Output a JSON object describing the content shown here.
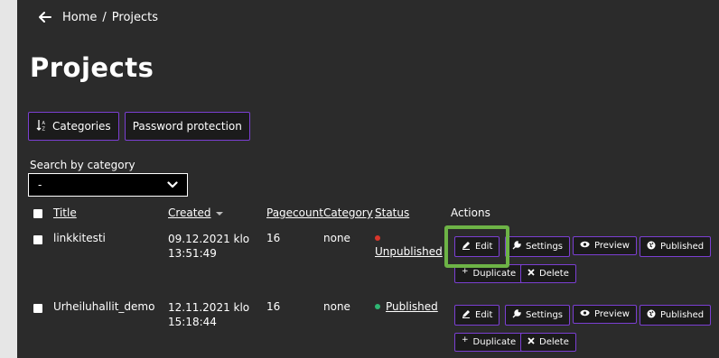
{
  "breadcrumb": {
    "items": [
      "Home",
      "/",
      "Projects"
    ]
  },
  "page": {
    "title": "Projects"
  },
  "top_buttons": {
    "categories": "Categories",
    "password_protection": "Password protection"
  },
  "search": {
    "label": "Search by category",
    "value": "-"
  },
  "table": {
    "headers": {
      "title": "Title",
      "created": "Created",
      "pagecount": "Pagecount",
      "category": "Category",
      "status": "Status",
      "actions": "Actions"
    },
    "rows": [
      {
        "title": "linkkitesti",
        "created_line1": "09.12.2021 klo",
        "created_line2": "13:51:49",
        "pagecount": "16",
        "category": "none",
        "status": "Unpublished",
        "status_color": "#d9362b"
      },
      {
        "title": "Urheiluhallit_demo",
        "created_line1": "12.11.2021 klo",
        "created_line2": "15:18:44",
        "pagecount": "16",
        "category": "none",
        "status": "Published",
        "status_color": "#2fb673"
      }
    ],
    "actions": {
      "edit": "Edit",
      "settings": "Settings",
      "preview": "Preview",
      "published": "Published",
      "duplicate": "Duplicate",
      "delete": "Delete"
    }
  },
  "colors": {
    "panel_bg": "#2b2b2b",
    "button_border": "#7b3fd2",
    "highlight": "#6db346"
  },
  "icons": {
    "back": "arrow-left-icon",
    "sort": "sort-alpha-icon",
    "dropdown": "chevron-down-icon",
    "edit": "pencil-icon",
    "settings": "wrench-icon",
    "preview": "eye-icon",
    "published": "globe-icon",
    "duplicate": "plus-icon",
    "delete": "x-icon"
  }
}
